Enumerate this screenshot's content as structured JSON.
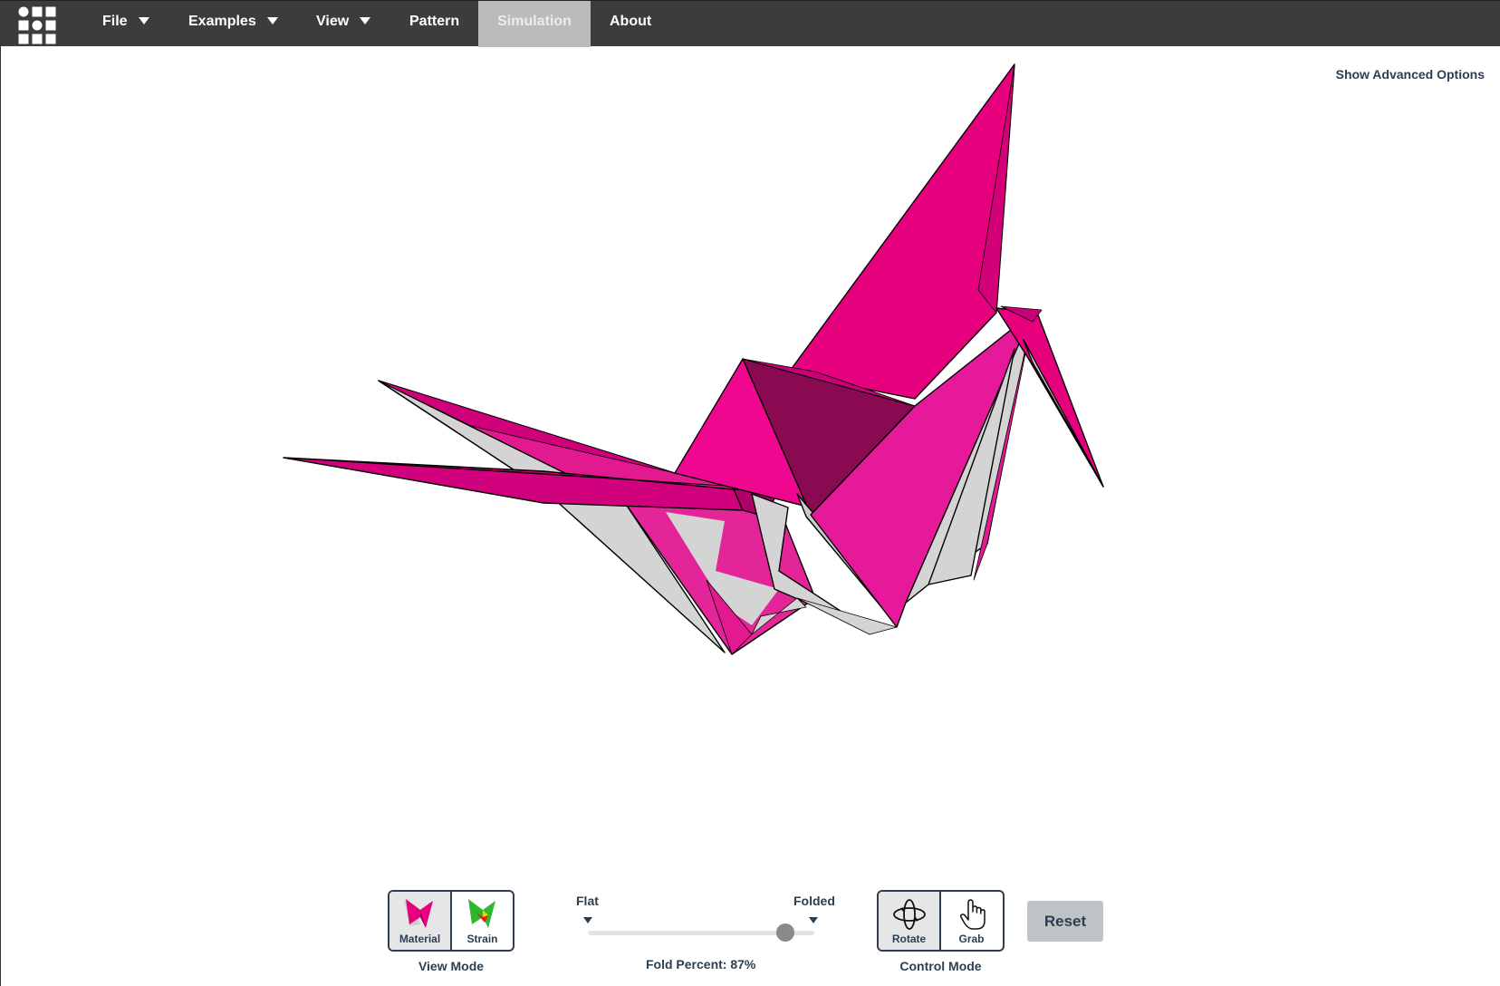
{
  "navbar": {
    "logo_icon": "grid-logo-icon",
    "items": [
      {
        "label": "File",
        "has_dropdown": true
      },
      {
        "label": "Examples",
        "has_dropdown": true
      },
      {
        "label": "View",
        "has_dropdown": true
      },
      {
        "label": "Pattern",
        "has_dropdown": false
      },
      {
        "label": "Simulation",
        "has_dropdown": false,
        "active": true
      },
      {
        "label": "About",
        "has_dropdown": false
      }
    ]
  },
  "advanced_options_label": "Show Advanced Options",
  "model": {
    "name": "origami-crane",
    "front_color": "#ec008c",
    "back_color": "#d4d4d4",
    "edge_color": "#000000"
  },
  "view_mode": {
    "caption": "View Mode",
    "options": [
      {
        "label": "Material",
        "icon": "material-icon",
        "selected": true
      },
      {
        "label": "Strain",
        "icon": "strain-icon",
        "selected": false
      }
    ]
  },
  "fold_slider": {
    "min_label": "Flat",
    "max_label": "Folded",
    "value_percent": 87,
    "readout": "Fold Percent: 87%"
  },
  "control_mode": {
    "caption": "Control Mode",
    "options": [
      {
        "label": "Rotate",
        "icon": "rotate-icon",
        "selected": true
      },
      {
        "label": "Grab",
        "icon": "hand-icon",
        "selected": false
      }
    ]
  },
  "reset_label": "Reset",
  "colors": {
    "navbar_bg": "#3c3c3c",
    "active_tab_bg": "#bbbbbb",
    "text": "#2c3e50",
    "reset_bg": "#bdc3c7"
  }
}
